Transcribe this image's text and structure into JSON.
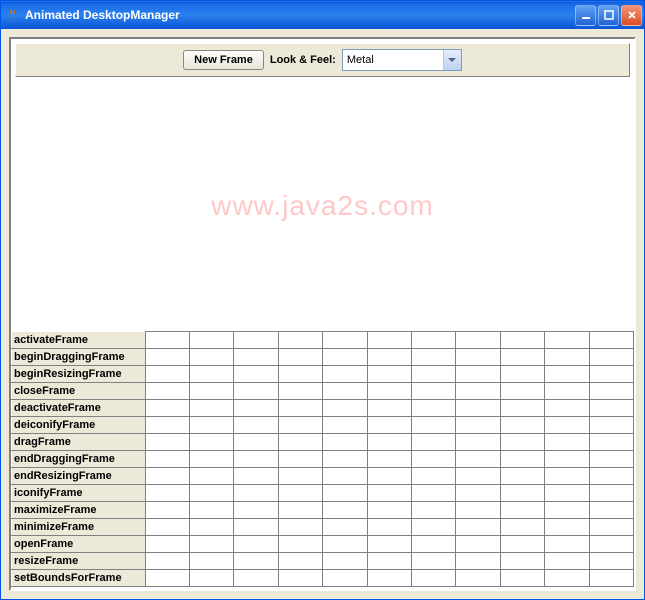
{
  "window": {
    "title": "Animated DesktopManager"
  },
  "toolbar": {
    "new_frame_label": "New Frame",
    "look_feel_label": "Look & Feel:",
    "look_feel_selected": "Metal"
  },
  "watermark": "www.java2s.com",
  "table": {
    "row_headers": [
      "activateFrame",
      "beginDraggingFrame",
      "beginResizingFrame",
      "closeFrame",
      "deactivateFrame",
      "deiconifyFrame",
      "dragFrame",
      "endDraggingFrame",
      "endResizingFrame",
      "iconifyFrame",
      "maximizeFrame",
      "minimizeFrame",
      "openFrame",
      "resizeFrame",
      "setBoundsForFrame"
    ],
    "column_count": 11
  }
}
